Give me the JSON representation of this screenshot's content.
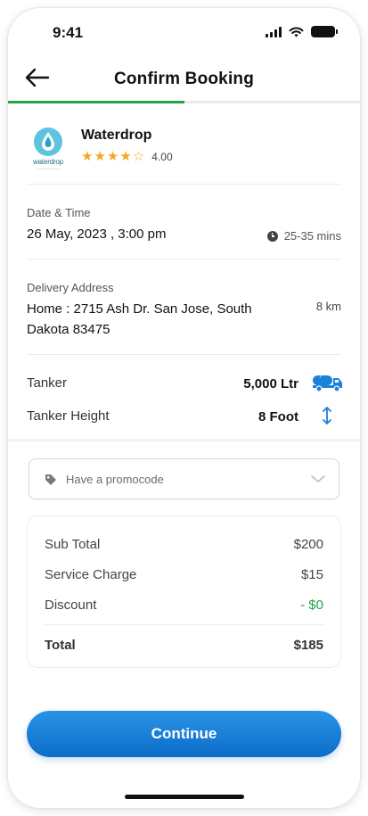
{
  "status_bar": {
    "time": "9:41"
  },
  "header": {
    "title": "Confirm Booking",
    "progress_fraction": 0.5
  },
  "vendor": {
    "name": "Waterdrop",
    "rating": "4.00",
    "stars_filled": 4,
    "stars_total": 5,
    "logo_text": "waterdrop"
  },
  "datetime": {
    "label": "Date & Time",
    "value": "26 May, 2023 , 3:00 pm",
    "eta": "25-35 mins"
  },
  "delivery": {
    "label": "Delivery Address",
    "address": "Home : 2715 Ash Dr. San Jose, South Dakota 83475",
    "distance": "8 km"
  },
  "tanker": {
    "label": "Tanker",
    "value": "5,000 Ltr",
    "height_label": "Tanker Height",
    "height_value": "8 Foot"
  },
  "promo": {
    "placeholder": "Have a promocode"
  },
  "summary": {
    "rows": [
      {
        "label": "Sub Total",
        "value": "$200"
      },
      {
        "label": "Service Charge",
        "value": "$15"
      },
      {
        "label": "Discount",
        "value": "- $0"
      }
    ],
    "total_label": "Total",
    "total_value": "$185"
  },
  "actions": {
    "continue_label": "Continue"
  },
  "colors": {
    "accent_blue": "#1a82db",
    "progress_green": "#25a244",
    "star": "#f5a623",
    "discount_green": "#1aa64a"
  },
  "icons": [
    "back-arrow-icon",
    "signal-icon",
    "wifi-icon",
    "battery-icon",
    "star-icon",
    "clock-icon",
    "truck-icon",
    "height-arrows-icon",
    "tag-icon",
    "chevron-down-icon"
  ]
}
